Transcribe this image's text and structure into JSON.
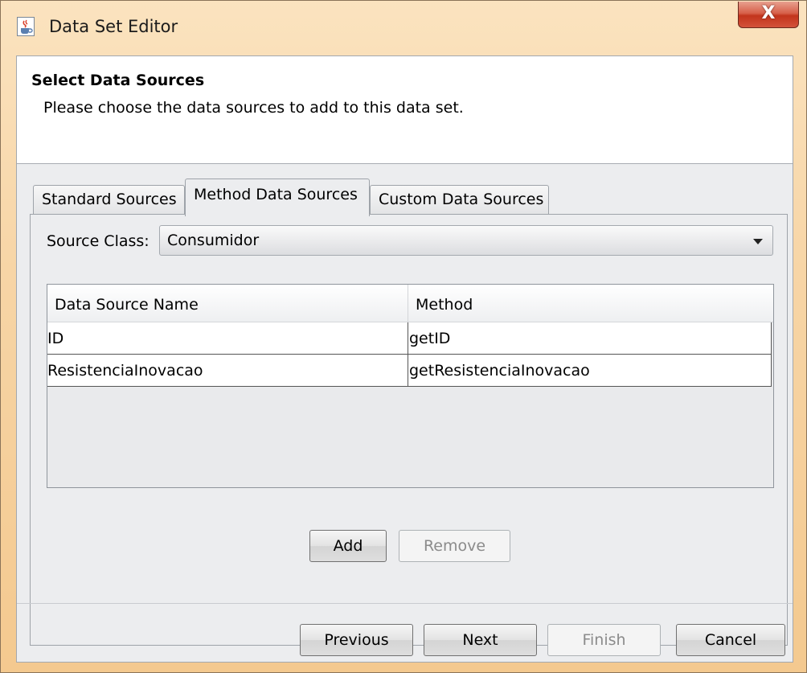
{
  "window": {
    "title": "Data Set Editor",
    "close_label": "X"
  },
  "header": {
    "title": "Select Data Sources",
    "description": "Please choose the data sources to add to this data set."
  },
  "tabs": [
    {
      "label": "Standard Sources",
      "active": false
    },
    {
      "label": "Method Data Sources",
      "active": true
    },
    {
      "label": "Custom Data Sources",
      "active": false
    }
  ],
  "method_tab": {
    "source_class_label": "Source Class:",
    "source_class_value": "Consumidor",
    "table": {
      "columns": [
        "Data Source Name",
        "Method"
      ],
      "rows": [
        [
          "ID",
          "getID"
        ],
        [
          "ResistenciaInovacao",
          "getResistenciaInovacao"
        ]
      ]
    },
    "add_label": "Add",
    "remove_label": "Remove"
  },
  "footer": {
    "previous_label": "Previous",
    "next_label": "Next",
    "finish_label": "Finish",
    "cancel_label": "Cancel"
  },
  "colors": {
    "title_bar": "#f7d5a6",
    "client_bg": "#ecedef",
    "close_button": "#d7604a"
  }
}
